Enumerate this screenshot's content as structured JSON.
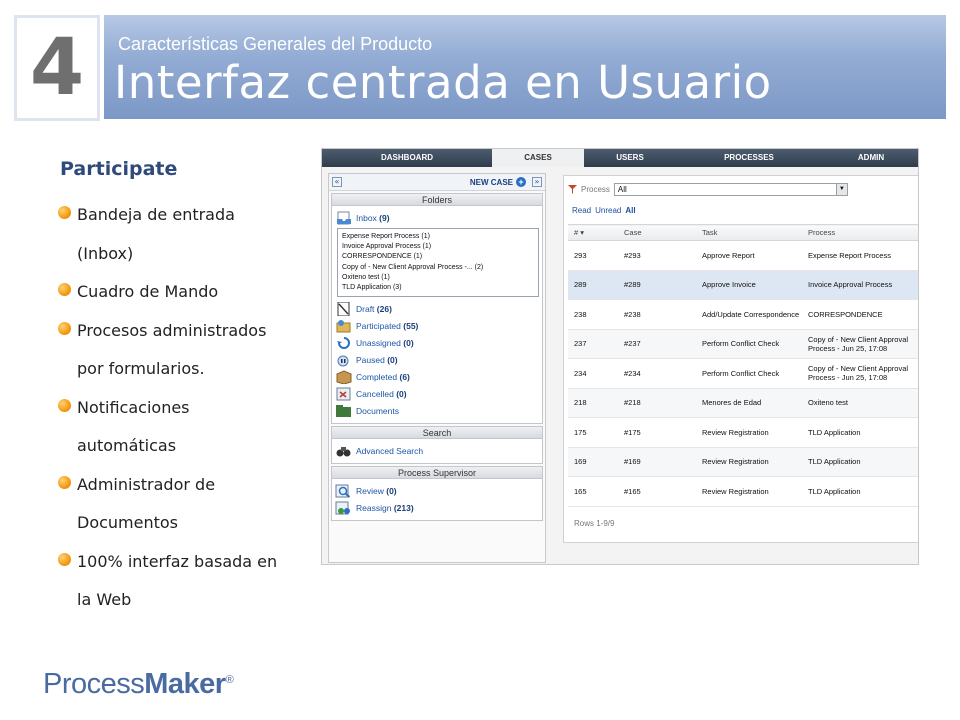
{
  "header": {
    "number": "4",
    "subtitle": "Características Generales del Producto",
    "title": "Interfaz centrada en Usuario"
  },
  "left": {
    "title": "Participate",
    "bullets": [
      "Bandeja de entrada",
      "(Inbox)",
      "Cuadro de Mando",
      "Procesos administrados",
      "por formularios.",
      "Notificaciones",
      "automáticas",
      "Administrador de",
      "Documentos",
      "100% interfaz basada en",
      "la Web"
    ]
  },
  "logo": {
    "part1": "Process",
    "part2": "Maker",
    "reg": "®"
  },
  "app": {
    "nav": [
      "DASHBOARD",
      "CASES",
      "USERS",
      "PROCESSES",
      "ADMIN"
    ],
    "new_case": "NEW CASE",
    "folders_header": "Folders",
    "inbox": {
      "label": "Inbox",
      "count": "(9)"
    },
    "inbox_items": [
      "Expense Report Process (1)",
      "Invoice Approval Process (1)",
      "CORRESPONDENCE (1)",
      "Copy of - New Client Approval Process -... (2)",
      "Oxiteno test (1)",
      "TLD Application (3)"
    ],
    "folders": [
      {
        "label": "Draft",
        "count": "(26)"
      },
      {
        "label": "Participated",
        "count": "(55)"
      },
      {
        "label": "Unassigned",
        "count": "(0)"
      },
      {
        "label": "Paused",
        "count": "(0)"
      },
      {
        "label": "Completed",
        "count": "(6)"
      },
      {
        "label": "Cancelled",
        "count": "(0)"
      },
      {
        "label": "Documents",
        "count": ""
      }
    ],
    "search_header": "Search",
    "advanced_search": "Advanced Search",
    "supervisor_header": "Process Supervisor",
    "supervisor": [
      {
        "label": "Review",
        "count": "(0)"
      },
      {
        "label": "Reassign",
        "count": "(213)"
      }
    ],
    "filter_label": "Process",
    "filter_value": "All",
    "links": [
      "Read",
      "Unread",
      "All"
    ],
    "columns": [
      "#",
      "Case",
      "Task",
      "Process"
    ],
    "rows": [
      {
        "num": "293",
        "case": "#293",
        "task": "Approve Report",
        "process": "Expense Report Process"
      },
      {
        "num": "289",
        "case": "#289",
        "task": "Approve Invoice",
        "process": "Invoice Approval Process"
      },
      {
        "num": "238",
        "case": "#238",
        "task": "Add/Update Correspondence",
        "process": "CORRESPONDENCE"
      },
      {
        "num": "237",
        "case": "#237",
        "task": "Perform Conflict Check",
        "process": "Copy of - New Client Approval Process - Jun 25, 17:08"
      },
      {
        "num": "234",
        "case": "#234",
        "task": "Perform Conflict Check",
        "process": "Copy of - New Client Approval Process - Jun 25, 17:08"
      },
      {
        "num": "218",
        "case": "#218",
        "task": "Menores de Edad",
        "process": "Oxiteno test"
      },
      {
        "num": "175",
        "case": "#175",
        "task": "Review Registration",
        "process": "TLD Application"
      },
      {
        "num": "169",
        "case": "#169",
        "task": "Review Registration",
        "process": "TLD Application"
      },
      {
        "num": "165",
        "case": "#165",
        "task": "Review Registration",
        "process": "TLD Application"
      }
    ],
    "rows_info": "Rows 1-9/9"
  }
}
